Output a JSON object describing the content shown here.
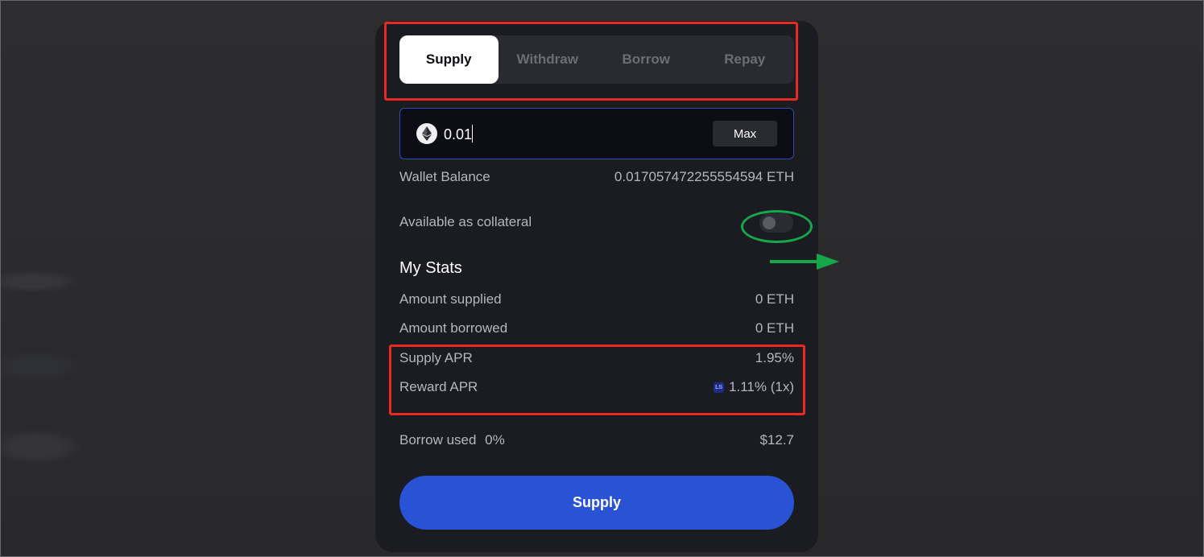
{
  "tabs": [
    {
      "label": "Supply",
      "active": true
    },
    {
      "label": "Withdraw",
      "active": false
    },
    {
      "label": "Borrow",
      "active": false
    },
    {
      "label": "Repay",
      "active": false
    }
  ],
  "amount": {
    "value": "0.01",
    "icon": "eth-icon",
    "max_label": "Max"
  },
  "wallet": {
    "label": "Wallet Balance",
    "value": "0.017057472255554594 ETH"
  },
  "collateral": {
    "label": "Available as collateral",
    "enabled": false
  },
  "stats": {
    "title": "My Stats",
    "amount_supplied_label": "Amount supplied",
    "amount_supplied_value": "0 ETH",
    "amount_borrowed_label": "Amount borrowed",
    "amount_borrowed_value": "0 ETH",
    "supply_apr_label": "Supply APR",
    "supply_apr_value": "1.95%",
    "reward_apr_label": "Reward APR",
    "reward_apr_value": "1.11% (1x)",
    "reward_icon_text": "LS"
  },
  "borrow": {
    "label": "Borrow used",
    "percent": "0%",
    "value": "$12.7"
  },
  "action": {
    "label": "Supply"
  },
  "colors": {
    "accent": "#2a52d4",
    "annotation_red": "#e82a23",
    "annotation_green": "#14a84a"
  }
}
